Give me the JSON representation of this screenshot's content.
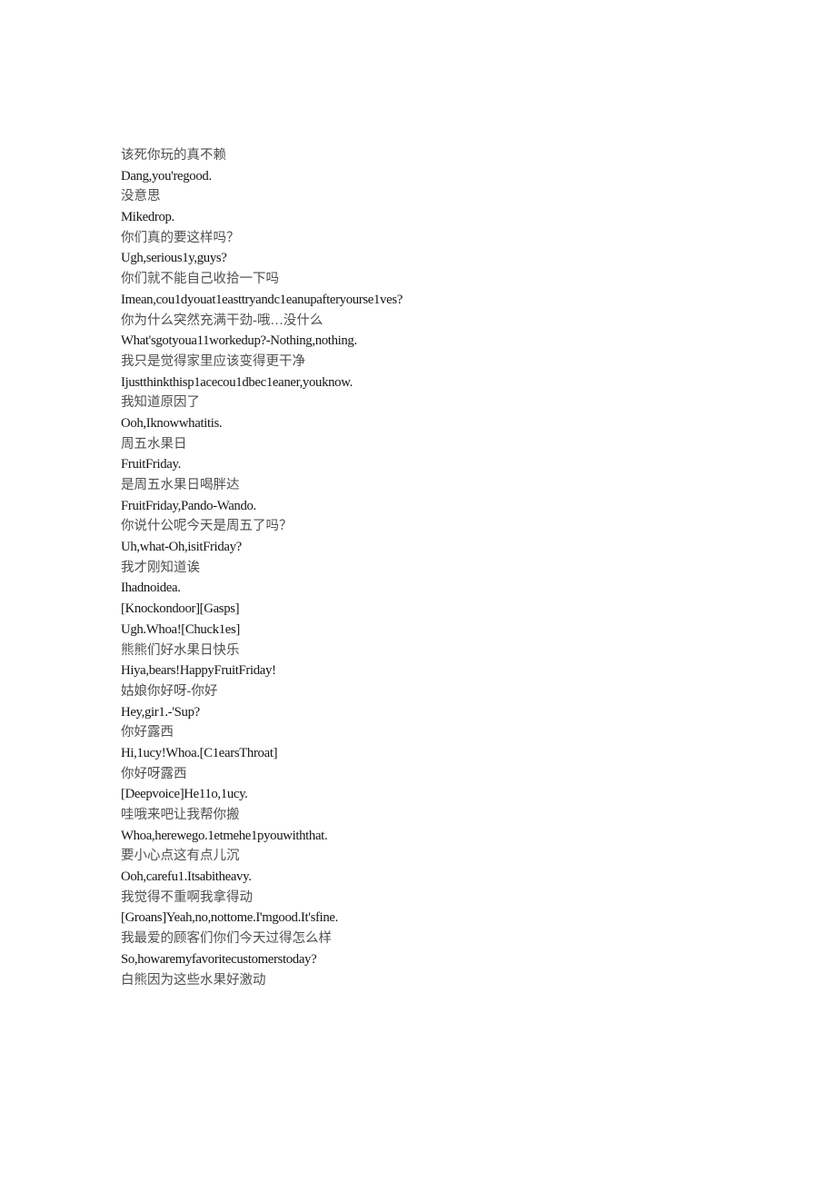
{
  "document": {
    "type": "bilingual-subtitle-transcript",
    "background_color": "#ffffff",
    "zh_text_color": "#4f4f4f",
    "en_text_color": "#151515",
    "lines": [
      {
        "lang": "zh",
        "text": "该死你玩的真不赖"
      },
      {
        "lang": "en",
        "text": "Dang,you'regood."
      },
      {
        "lang": "zh",
        "text": "没意思"
      },
      {
        "lang": "en",
        "text": "Mikedrop."
      },
      {
        "lang": "zh",
        "text": "你们真的要这样吗？"
      },
      {
        "lang": "en",
        "text": "Ugh,serious1y,guys?"
      },
      {
        "lang": "zh",
        "text": "你们就不能自己收拾一下吗"
      },
      {
        "lang": "en",
        "text": "Imean,cou1dyouat1easttryandc1eanupafteryourse1ves?"
      },
      {
        "lang": "zh",
        "text": "你为什么突然充满干劲-哦…没什么"
      },
      {
        "lang": "en",
        "text": "What'sgotyoua11workedup?-Nothing,nothing."
      },
      {
        "lang": "zh",
        "text": "我只是觉得家里应该变得更干净"
      },
      {
        "lang": "en",
        "text": "Ijustthinkthisp1acecou1dbec1eaner,youknow."
      },
      {
        "lang": "zh",
        "text": "我知道原因了"
      },
      {
        "lang": "en",
        "text": "Ooh,Iknowwhatitis."
      },
      {
        "lang": "zh",
        "text": "周五水果日"
      },
      {
        "lang": "en",
        "text": "FruitFriday."
      },
      {
        "lang": "zh",
        "text": "是周五水果日喝胖达"
      },
      {
        "lang": "en",
        "text": "FruitFriday,Pando-Wando."
      },
      {
        "lang": "zh",
        "text": "你说什公呢今天是周五了吗？"
      },
      {
        "lang": "en",
        "text": "Uh,what-Oh,isitFriday?"
      },
      {
        "lang": "zh",
        "text": "我才刚知道诶"
      },
      {
        "lang": "en",
        "text": "Ihadnoidea."
      },
      {
        "lang": "en",
        "text": "[Knockondoor][Gasps]"
      },
      {
        "lang": "en",
        "text": "Ugh.Whoa![Chuck1es]"
      },
      {
        "lang": "zh",
        "text": "熊熊们好水果日快乐"
      },
      {
        "lang": "en",
        "text": "Hiya,bears!HappyFruitFriday!"
      },
      {
        "lang": "zh",
        "text": "姑娘你好呀-你好"
      },
      {
        "lang": "en",
        "text": "Hey,gir1.-'Sup?"
      },
      {
        "lang": "zh",
        "text": "你好露西"
      },
      {
        "lang": "en",
        "text": "Hi,1ucy!Whoa.[C1earsThroat]"
      },
      {
        "lang": "zh",
        "text": "你好呀露西"
      },
      {
        "lang": "en",
        "text": "[Deepvoice]He11o,1ucy."
      },
      {
        "lang": "zh",
        "text": "哇哦来吧让我帮你搬"
      },
      {
        "lang": "en",
        "text": "Whoa,herewego.1etmehe1pyouwiththat."
      },
      {
        "lang": "zh",
        "text": "要小心点这有点儿沉"
      },
      {
        "lang": "en",
        "text": "Ooh,carefu1.Itsabitheavy."
      },
      {
        "lang": "zh",
        "text": "我觉得不重啊我拿得动"
      },
      {
        "lang": "en",
        "text": "[Groans]Yeah,no,nottome.I'mgood.It'sfine."
      },
      {
        "lang": "zh",
        "text": "我最爱的顾客们你们今天过得怎么样"
      },
      {
        "lang": "en",
        "text": "So,howaremyfavoritecustomerstoday?"
      },
      {
        "lang": "zh",
        "text": "白熊因为这些水果好激动"
      }
    ]
  }
}
